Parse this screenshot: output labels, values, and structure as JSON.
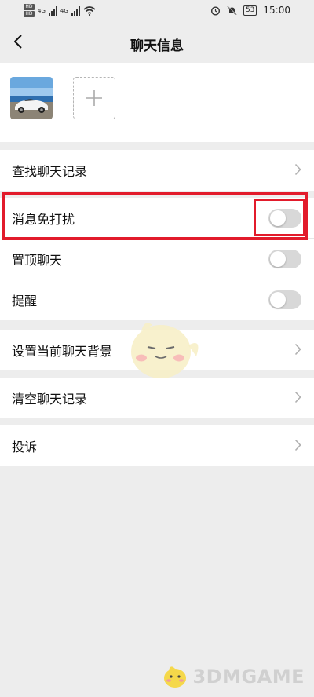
{
  "status_bar": {
    "sim1": "HD",
    "sim2": "HD",
    "network1": "4G",
    "network2": "4G",
    "battery": "53",
    "time": "15:00"
  },
  "nav": {
    "title": "聊天信息",
    "back_icon": "chevron-left-icon"
  },
  "members": {
    "avatar_icon": "car-photo-avatar",
    "add_icon": "plus-icon"
  },
  "settings": {
    "search_history": "查找聊天记录",
    "do_not_disturb": "消息免打扰",
    "pin_chat": "置顶聊天",
    "remind": "提醒",
    "set_background": "设置当前聊天背景",
    "clear_history": "清空聊天记录",
    "report": "投诉"
  },
  "toggles": {
    "do_not_disturb": false,
    "pin_chat": false,
    "remind": false
  },
  "colors": {
    "highlight": "#e21b2b",
    "background": "#ededed",
    "toggle_off": "#d8d8d8"
  },
  "watermark": {
    "text": "3DMGAME"
  }
}
